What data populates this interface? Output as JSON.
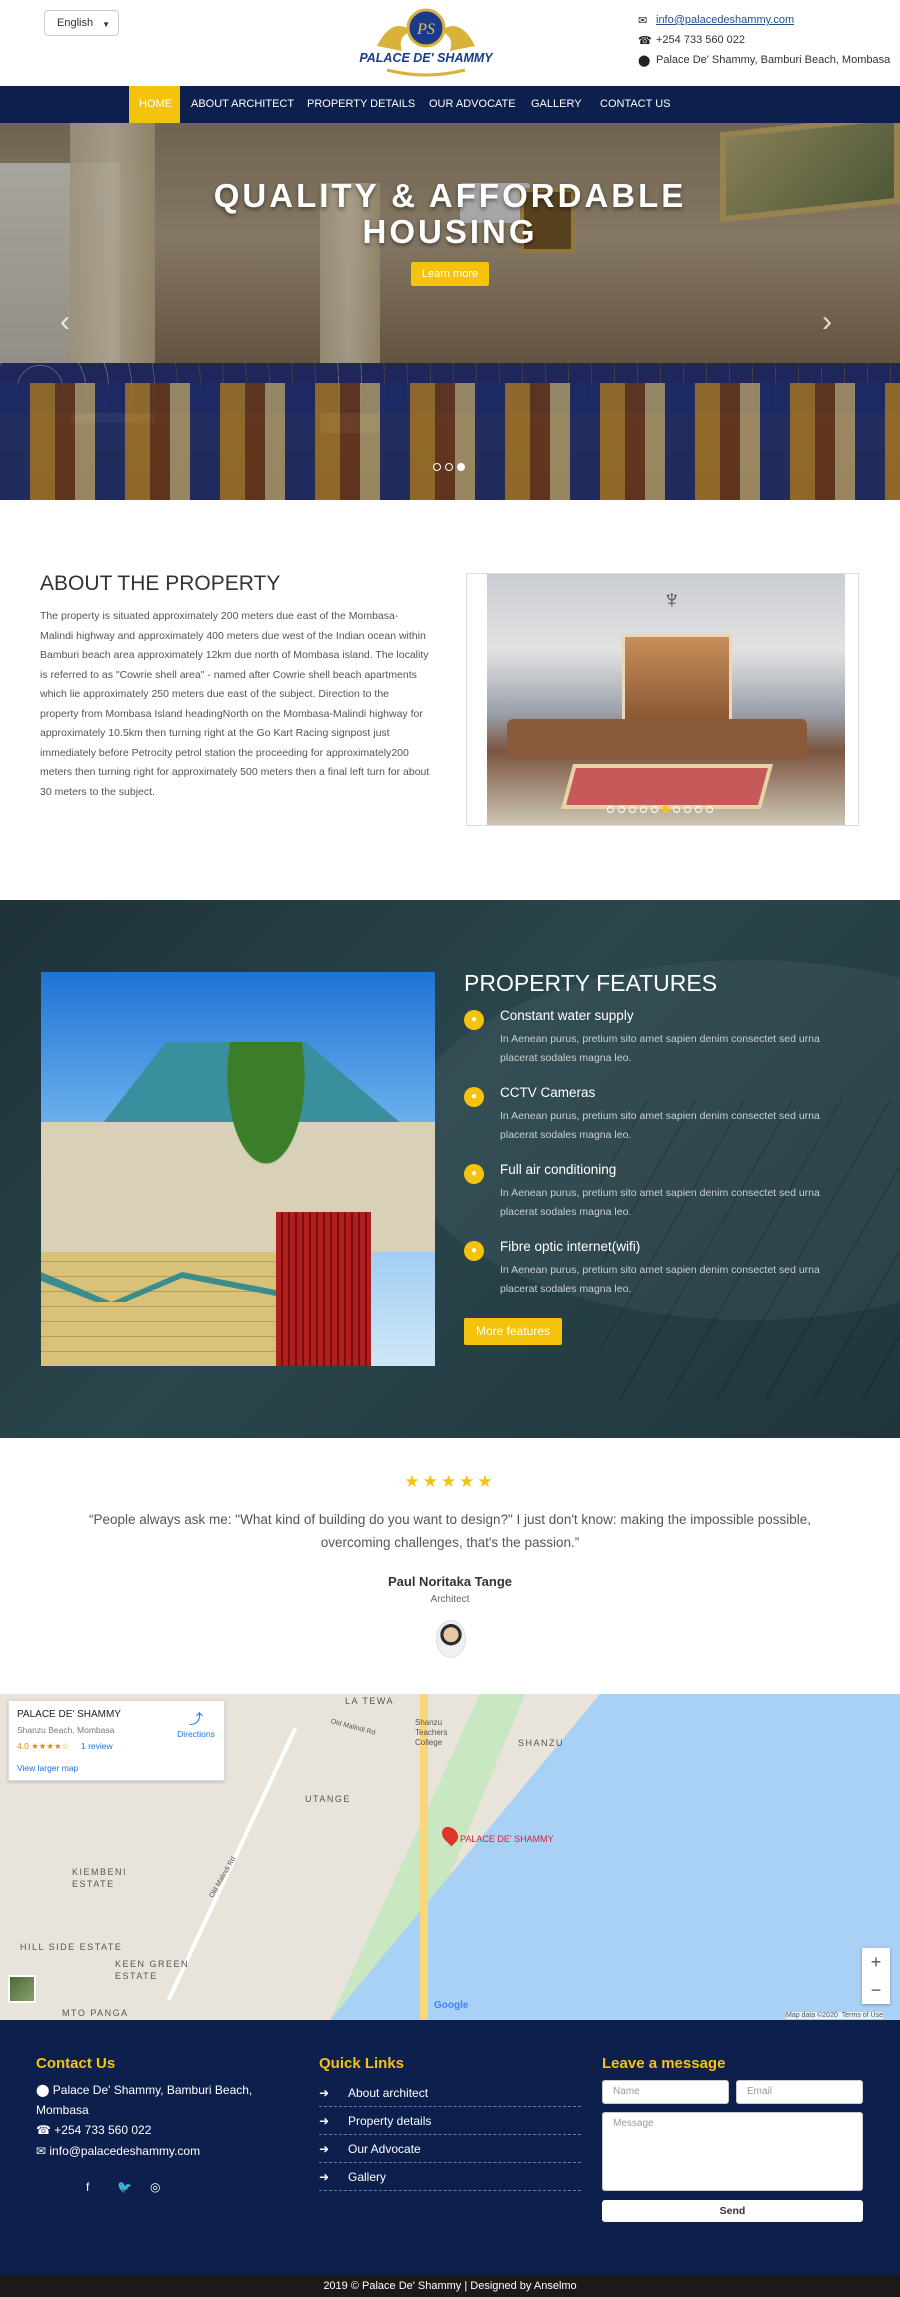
{
  "header": {
    "language": "English",
    "brand": "PALACE DE' SHAMMY",
    "monogram": "PS",
    "email": "info@palacedeshammy.com",
    "phone": "+254 733 560 022",
    "address": "Palace De' Shammy, Bamburi Beach, Mombasa"
  },
  "nav": {
    "items": [
      "HOME",
      "ABOUT ARCHITECT",
      "PROPERTY DETAILS",
      "OUR ADVOCATE",
      "GALLERY",
      "CONTACT US"
    ]
  },
  "hero": {
    "title": "QUALITY & AFFORDABLE HOUSING",
    "button": "Learn more",
    "prev_icon": "chevron-left-icon",
    "next_icon": "chevron-right-icon"
  },
  "about": {
    "title": "ABOUT THE PROPERTY",
    "text": "The property is situated approximately 200 meters due east of the Mombasa-Malindi highway and approximately 400 meters due west of the Indian ocean within Bamburi beach area approximately 12km due north of Mombasa island. The locality is referred to as \"Cowrie shell area\" - named after Cowrie shell beach apartments which lie approximately 250 meters due east of the subject. Direction to the property from Mombasa Island headingNorth on the Mombasa-Malindi highway for approximately 10.5km then turning right at the Go Kart Racing signpost just immediately before Petrocity petrol station the proceeding for approximately200 meters then turning right for approximately 500 meters then a final left turn for about 30 meters to the subject."
  },
  "features": {
    "title": "PROPERTY FEATURES",
    "items": [
      {
        "title": "Constant water supply",
        "text": "In Aenean purus, pretium sito amet sapien denim consectet sed urna placerat sodales magna leo."
      },
      {
        "title": "CCTV Cameras",
        "text": "In Aenean purus, pretium sito amet sapien denim consectet sed urna placerat sodales magna leo."
      },
      {
        "title": "Full air conditioning",
        "text": "In Aenean purus, pretium sito amet sapien denim consectet sed urna placerat sodales magna leo."
      },
      {
        "title": "Fibre optic internet(wifi)",
        "text": "In Aenean purus, pretium sito amet sapien denim consectet sed urna placerat sodales magna leo."
      }
    ],
    "button": "More features"
  },
  "testimonial": {
    "stars": "★★★★★",
    "quote": "“People always ask me: \"What kind of building do you want to design?\" I just don't know: making the impossible possible, overcoming challenges, that's the passion.”",
    "author": "Paul Noritaka Tange",
    "role": "Architect"
  },
  "map": {
    "place_name": "PALACE DE' SHAMMY",
    "place_address": "Shanzu Beach, Mombasa",
    "rating": "4.0 ★★★★☆",
    "reviews": "1 review",
    "directions": "Directions",
    "view_larger": "View larger map",
    "pin_label": "PALACE DE' SHAMMY",
    "labels": [
      "LA TEWA",
      "SHANZU",
      "UTANGE",
      "KIEMBENI ESTATE",
      "HILL SIDE ESTATE",
      "KEEN GREEN ESTATE",
      "MTO PANGA",
      "Shanzu Teachers College"
    ],
    "roads": [
      "Old Malindi Rd",
      "Old Malindi Rd"
    ],
    "google": "Google",
    "map_data": "Map data ©2020",
    "terms": "Terms of Use",
    "zoom_in": "+",
    "zoom_out": "−"
  },
  "footer": {
    "contact_title": "Contact Us",
    "contact_address": "Palace De' Shammy, Bamburi Beach, Mombasa",
    "contact_phone": "+254 733 560 022",
    "contact_email": "info@palacedeshammy.com",
    "social": [
      "facebook-icon",
      "twitter-icon",
      "instagram-icon"
    ],
    "links_title": "Quick Links",
    "links": [
      "About architect",
      "Property details",
      "Our Advocate",
      "Gallery"
    ],
    "message_title": "Leave a message",
    "name_placeholder": "Name",
    "email_placeholder": "Email",
    "message_placeholder": "Message",
    "send": "Send",
    "copyright": "2019 © Palace De' Shammy | Designed by Anselmo"
  },
  "colors": {
    "accent": "#f5c30c",
    "navy": "#0d1f4d",
    "teal": "#2a454c"
  }
}
